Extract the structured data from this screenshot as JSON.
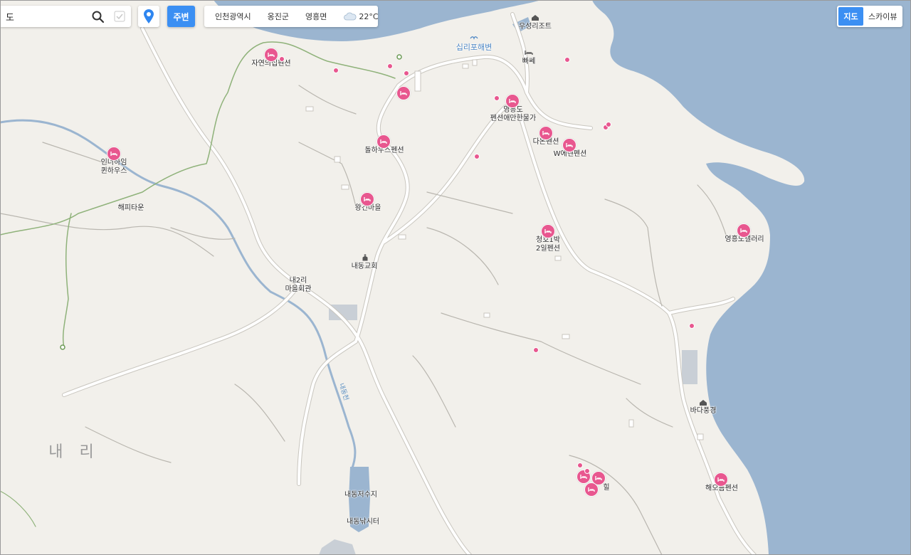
{
  "search": {
    "value": "도",
    "placeholder": ""
  },
  "nearby_button": "주변",
  "breadcrumb": [
    "인천광역시",
    "옹진군",
    "영흥면"
  ],
  "weather": {
    "icon": "cloud-icon",
    "temp": "22°C"
  },
  "map_type": {
    "map": "지도",
    "skyview": "스카이뷰"
  },
  "place_labels": {
    "pension_jayeon": "자연의집펜션",
    "siripo_beach": "십리포해변",
    "useong_resort": "우성리조트",
    "bbase": "빠쎄",
    "yeongheungdo_pension": "영흥도\n펜션애만한물가",
    "daon_pension": "다온펜션",
    "w_eden": "W에덴펜션",
    "dolhouse": "돌하우스펜션",
    "inn_queenhouse": "인너하임\n퀸하우스",
    "happytown": "해피타운",
    "wanggeon_maeul": "왕건마을",
    "naedong_church": "내동교회",
    "nae2ri_hall": "내2리\n마을회관",
    "cheongho": "청호1박\n2일펜션",
    "yeongheungdo_gallery": "영흥도갤러리",
    "bada_punggyeong": "바다풍경",
    "haeoreum": "해오름펜션",
    "area_naeri": "내 리",
    "naedong_reservoir": "내동저수지",
    "naedong_fishing": "내동낚시터",
    "stream": "내동천",
    "hill_frag": "힐"
  },
  "colors": {
    "water": "#9bb5d0",
    "land": "#f2f0eb",
    "road": "#ffffff",
    "road_edge": "#c9c6bf",
    "pin": "#e8578f",
    "accent": "#3b8ff3"
  }
}
